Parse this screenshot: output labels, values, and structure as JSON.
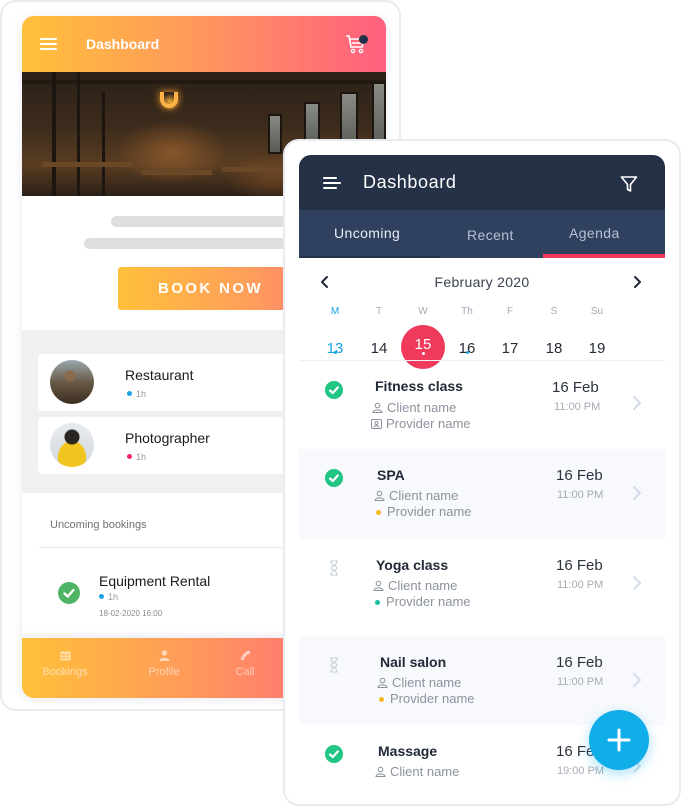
{
  "phone1": {
    "header": {
      "title": "Dashboard",
      "menu_icon": "hamburger-icon",
      "cart_icon": "cart-icon",
      "cart_badge_color": "#23304a"
    },
    "book_button": "BOOK NOW",
    "services": [
      {
        "title": "Restaurant",
        "duration": "1h",
        "dot_color": "#1aa3e2"
      },
      {
        "title": "Photographer",
        "duration": "1h",
        "dot_color": "#f0226a"
      }
    ],
    "upcoming": {
      "section_label": "Uncoming bookings",
      "items": [
        {
          "title": "Equipment Rental",
          "duration": "1h",
          "datetime": "18-02-2020 16:00",
          "status": "confirmed"
        }
      ]
    },
    "bottom_nav": [
      {
        "label": "Bookings",
        "icon": "calendar-icon"
      },
      {
        "label": "Profile",
        "icon": "person-icon"
      },
      {
        "label": "Call",
        "icon": "phone-icon"
      }
    ],
    "gradient": [
      "#ffc03a",
      "#ff9b5a",
      "#ff5f80"
    ]
  },
  "phone2": {
    "header": {
      "title": "Dashboard",
      "menu_icon": "hamburger-icon",
      "filter_icon": "filter-icon"
    },
    "tabs": [
      {
        "label": "Uncoming",
        "active": false
      },
      {
        "label": "Recent",
        "active": false
      },
      {
        "label": "Agenda",
        "active": true
      }
    ],
    "calendar": {
      "month": "February 2020",
      "weekdays": [
        "M",
        "T",
        "W",
        "Th",
        "F",
        "S",
        "Su"
      ],
      "days": [
        {
          "day": "13",
          "highlight": "blue",
          "has_event": true
        },
        {
          "day": "14",
          "highlight": "",
          "has_event": false
        },
        {
          "day": "15",
          "highlight": "selected",
          "has_event": true
        },
        {
          "day": "16",
          "highlight": "",
          "has_event": true
        },
        {
          "day": "17",
          "highlight": "",
          "has_event": false
        },
        {
          "day": "18",
          "highlight": "",
          "has_event": false
        },
        {
          "day": "19",
          "highlight": "",
          "has_event": false
        }
      ]
    },
    "agenda": [
      {
        "title": "Fitness class",
        "client": "Client name",
        "provider": "Provider name",
        "provider_marker": "id-card",
        "date": "16 Feb",
        "time": "11:00 PM",
        "status": "confirmed"
      },
      {
        "title": "SPA",
        "client": "Client name",
        "provider": "Provider name",
        "provider_marker": "#f5b922",
        "date": "16 Feb",
        "time": "11:00 PM",
        "status": "confirmed"
      },
      {
        "title": "Yoga class",
        "client": "Client name",
        "provider": "Provider name",
        "provider_marker": "#16c2a3",
        "date": "16 Feb",
        "time": "11:00 PM",
        "status": "pending"
      },
      {
        "title": "Nail salon",
        "client": "Client name",
        "provider": "Provider name",
        "provider_marker": "#f5b922",
        "date": "16 Feb",
        "time": "11:00 PM",
        "status": "pending"
      },
      {
        "title": "Massage",
        "client": "Client name",
        "provider": "",
        "provider_marker": "",
        "date": "16 Feb",
        "time": "19:00 PM",
        "status": "confirmed"
      }
    ],
    "fab_icon": "plus-icon",
    "colors": {
      "header": "#253147",
      "tabs": "#2f415f",
      "accent": "#ef3a5b",
      "fab": "#10aee8",
      "confirmed": "#22c584"
    }
  }
}
